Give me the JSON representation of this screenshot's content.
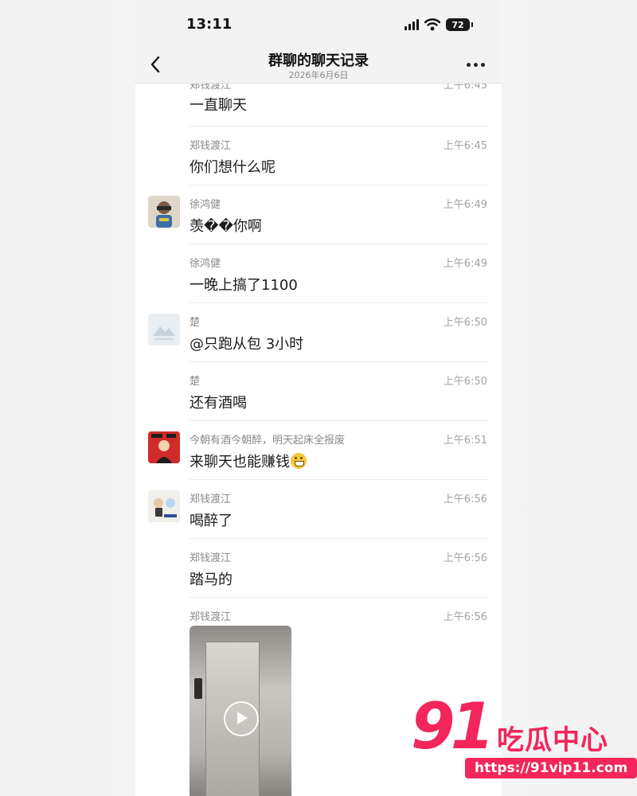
{
  "status": {
    "time": "13:11",
    "battery": "72"
  },
  "nav": {
    "title": "群聊的聊天记录",
    "subtitle": "2026年6月6日"
  },
  "messages": [
    {
      "sender": "郑钱渡江",
      "time": "上午6:45",
      "text": "一直聊天",
      "avatar": "none"
    },
    {
      "sender": "郑钱渡江",
      "time": "上午6:45",
      "text": "你们想什么呢",
      "avatar": "none"
    },
    {
      "sender": "徐鸿健",
      "time": "上午6:49",
      "text": "羡��你啊",
      "avatar": "photo-child"
    },
    {
      "sender": "徐鸿健",
      "time": "上午6:49",
      "text": "一晚上搞了1100",
      "avatar": "none"
    },
    {
      "sender": "楚",
      "time": "上午6:50",
      "text": "@只跑从包 3小时",
      "avatar": "landscape"
    },
    {
      "sender": "楚",
      "time": "上午6:50",
      "text": "还有酒喝",
      "avatar": "none"
    },
    {
      "sender": "今朝有酒今朝醉，明天起床全报废",
      "time": "上午6:51",
      "text": "来聊天也能赚钱",
      "avatar": "red-character",
      "emoji": "grinning-emoji"
    },
    {
      "sender": "郑钱渡江",
      "time": "上午6:56",
      "text": "喝醉了",
      "avatar": "cartoon-sticker"
    },
    {
      "sender": "郑钱渡江",
      "time": "上午6:56",
      "text": "踏马的",
      "avatar": "none"
    },
    {
      "sender": "郑钱渡江",
      "time": "上午6:56",
      "text": "",
      "avatar": "none",
      "media": "video"
    }
  ],
  "watermark": {
    "logo_num": "91",
    "logo_text": "吃瓜中心",
    "url": "https://91vip11.com",
    "color": "#f2265a"
  }
}
